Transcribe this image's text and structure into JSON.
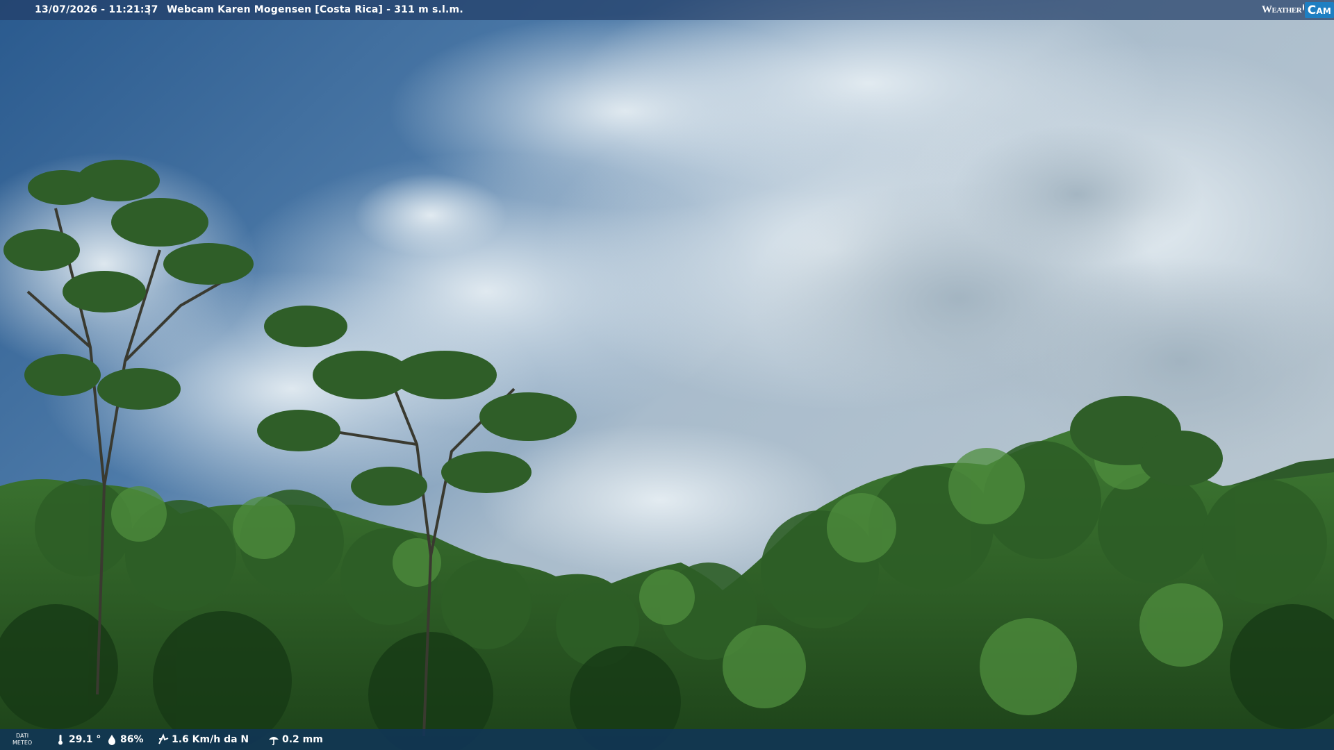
{
  "header": {
    "datetime": "13/07/2026 - 11:21:37",
    "separator": "|",
    "camera_title": "Webcam Karen Mogensen [Costa Rica] - 311 m s.l.m.",
    "logo_word": "Weather",
    "logo_cam": "Cam"
  },
  "weather": {
    "label_line1": "DATI",
    "label_line2": "METEO",
    "temperature": "29.1 °",
    "humidity": "86%",
    "wind": "1.6 Km/h da N",
    "rain": "0.2 mm"
  },
  "icons": {
    "temperature": "thermometer-icon",
    "humidity": "drop-icon",
    "wind": "wind-icon",
    "rain": "rain-icon"
  },
  "colors": {
    "sky_top": "#2d5d92",
    "cloud": "#d7e3ec",
    "foliage_dark": "#1f4a1e",
    "foliage_light": "#4c8a3c",
    "bar_top": "#223e68",
    "bar_bottom": "#10345c"
  }
}
